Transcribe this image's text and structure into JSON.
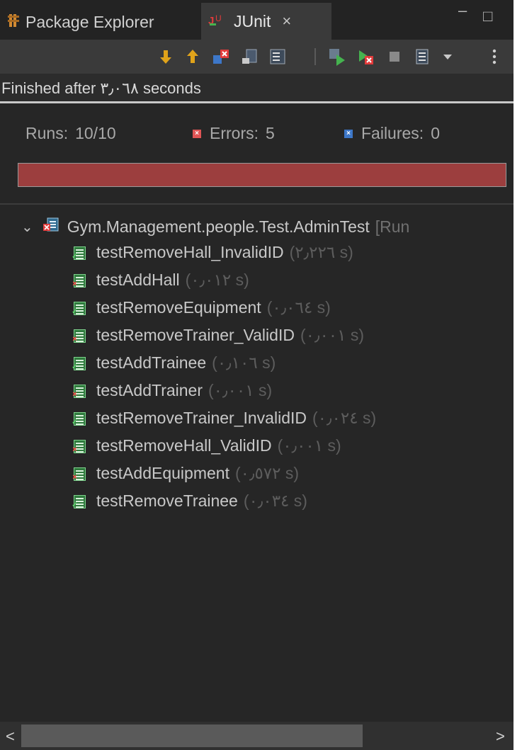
{
  "tabs": {
    "package_explorer": {
      "label": "Package Explorer",
      "icon": "package-explorer-icon"
    },
    "junit": {
      "label": "JUnit",
      "icon": "junit-icon",
      "close": "×"
    }
  },
  "window_controls": {
    "minimize": "–",
    "maximize": "□"
  },
  "toolbar": {
    "icons": [
      "next-failure-icon",
      "previous-failure-icon",
      "show-failures-only-icon",
      "scroll-lock-icon",
      "show-skipped-icon",
      "rerun-icon",
      "rerun-failed-first-icon",
      "stop-icon",
      "history-icon",
      "dropdown-icon",
      "view-menu-icon"
    ],
    "colors": {
      "arrow": "#e0a31a",
      "rerun": "#45b34f",
      "error": "#e23b3b",
      "neutral": "#a6a6a6"
    }
  },
  "status": {
    "text": "Finished after ٣٫٠٦٨ seconds"
  },
  "counts": {
    "runs_label": "Runs:",
    "runs_value": "10/10",
    "errors_label": "Errors:",
    "errors_value": "5",
    "failures_label": "Failures:",
    "failures_value": "0"
  },
  "progress": {
    "fraction": 1.0,
    "color": "#9c3e3e"
  },
  "tree": {
    "root": {
      "label": "Gym.Management.people.Test.AdminTest",
      "suffix": "[Run",
      "expanded": true
    },
    "tests": [
      {
        "name": "testRemoveHall_InvalidID",
        "time": "(٢٫٢٢٦ s)",
        "status": "pass"
      },
      {
        "name": "testAddHall",
        "time": "(٠٫٠١٢ s)",
        "status": "error"
      },
      {
        "name": "testRemoveEquipment",
        "time": "(٠٫٠٦٤ s)",
        "status": "pass"
      },
      {
        "name": "testRemoveTrainer_ValidID",
        "time": "(٠٫٠٠١ s)",
        "status": "error"
      },
      {
        "name": "testAddTrainee",
        "time": "(٠٫١٠٦ s)",
        "status": "pass"
      },
      {
        "name": "testAddTrainer",
        "time": "(٠٫٠٠١ s)",
        "status": "error"
      },
      {
        "name": "testRemoveTrainer_InvalidID",
        "time": "(٠٫٠٢٤ s)",
        "status": "pass"
      },
      {
        "name": "testRemoveHall_ValidID",
        "time": "(٠٫٠٠١ s)",
        "status": "error"
      },
      {
        "name": "testAddEquipment",
        "time": "(٠٫٥٧٢ s)",
        "status": "error"
      },
      {
        "name": "testRemoveTrainee",
        "time": "(٠٫٠٣٤ s)",
        "status": "pass"
      }
    ]
  },
  "scrollbar": {
    "left": "<",
    "right": ">"
  }
}
